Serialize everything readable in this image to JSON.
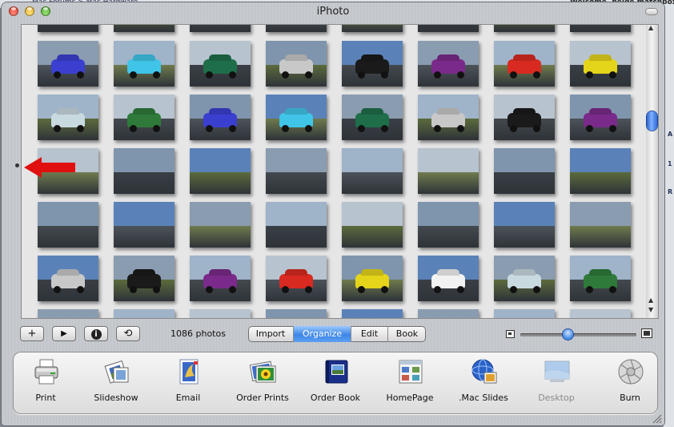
{
  "background": {
    "left_text": "Mac Forums > Mac Hardware",
    "right_text": "Welcome, belde matchbox",
    "right_marks": [
      "A",
      "1",
      "R"
    ]
  },
  "window": {
    "title": "iPhoto"
  },
  "photos": {
    "colors": {
      "sky": [
        "#5a82b8",
        "#8a9cb0",
        "#9fb3c9",
        "#b7c3cf",
        "#7f95ad"
      ],
      "ground": [
        "#3a3f46",
        "#4d535a",
        "#5c6b3d",
        "#6f7b4e",
        "#44494f"
      ],
      "cars": [
        "#1f6e4a",
        "#d82a20",
        "#2f7a3a",
        "#c8c8c8",
        "#e4d41a",
        "#3b3fd0",
        "#1a1a1a",
        "#f2f2f2",
        "#40c4e8",
        "#7a2a8a",
        "#c9d9e0"
      ]
    }
  },
  "toolbar": {
    "add_label": "+",
    "play_label": "▶",
    "info_label": "i",
    "rotate_label": "⟲",
    "photo_count": "1086 photos",
    "modes": [
      {
        "label": "Import",
        "selected": false
      },
      {
        "label": "Organize",
        "selected": true
      },
      {
        "label": "Edit",
        "selected": false
      },
      {
        "label": "Book",
        "selected": false
      }
    ]
  },
  "zoom": {
    "level": 0.41
  },
  "tools": [
    {
      "label": "Print",
      "icon": "printer-icon",
      "enabled": true
    },
    {
      "label": "Slideshow",
      "icon": "slideshow-icon",
      "enabled": true
    },
    {
      "label": "Email",
      "icon": "email-icon",
      "enabled": true
    },
    {
      "label": "Order Prints",
      "icon": "order-prints-icon",
      "enabled": true
    },
    {
      "label": "Order Book",
      "icon": "order-book-icon",
      "enabled": true
    },
    {
      "label": "HomePage",
      "icon": "homepage-icon",
      "enabled": true
    },
    {
      "label": ".Mac Slides",
      "icon": "mac-slides-icon",
      "enabled": true
    },
    {
      "label": "Desktop",
      "icon": "desktop-icon",
      "enabled": false
    },
    {
      "label": "Burn",
      "icon": "burn-icon",
      "enabled": true
    }
  ]
}
